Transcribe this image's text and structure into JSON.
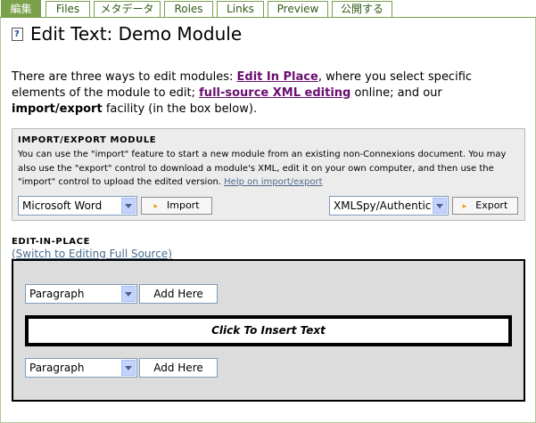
{
  "tabs": [
    {
      "label": "編集",
      "active": true
    },
    {
      "label": "Files"
    },
    {
      "label": "メタデータ"
    },
    {
      "label": "Roles"
    },
    {
      "label": "Links"
    },
    {
      "label": "Preview"
    },
    {
      "label": "公開する"
    }
  ],
  "page": {
    "title": "Edit Text: Demo Module",
    "intro": {
      "p1": "There are three ways to edit modules: ",
      "link1": "Edit In Place",
      "p2": ", where you select specific elements of the module to edit; ",
      "link2": "full-source XML editing",
      "p3": " online; and our ",
      "bold": "import/export",
      "p4": " facility (in the box below)."
    }
  },
  "import_export": {
    "heading": "IMPORT/EXPORT MODULE",
    "text": "You can use the \"import\" feature to start a new module from an existing non-Connexions document. You may also use the \"export\" control to download a module's XML, edit it on your own computer, and then use the \"import\" control to upload the edited version. ",
    "help_link": "Help on import/export",
    "import_format": "Microsoft Word",
    "import_button": "Import",
    "export_format": "XMLSpy/Authentic",
    "export_button": "Export"
  },
  "edit_in_place": {
    "heading": "EDIT-IN-PLACE",
    "switch_link": "(Switch to Editing Full Source)",
    "top_select": "Paragraph",
    "top_add": "Add Here",
    "insert_text": "Click To Insert Text",
    "bottom_select": "Paragraph",
    "bottom_add": "Add Here"
  },
  "colors": {
    "tab_accent": "#7aa04a",
    "link_purple": "#6a0e71",
    "link_blue": "#4b6b8a"
  }
}
